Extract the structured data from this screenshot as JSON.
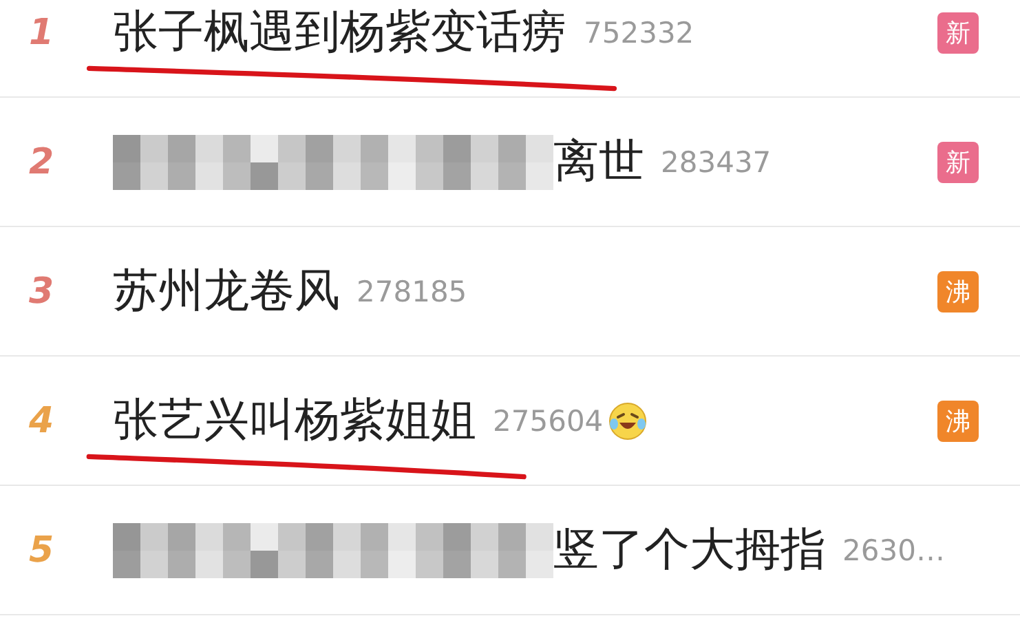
{
  "hot_list": [
    {
      "rank": "1",
      "color": "#e07a72",
      "redacted": false,
      "title": "张子枫遇到杨紫变话痨",
      "count": "752332",
      "emoji": false,
      "underlined": true,
      "badge": {
        "label": "新",
        "color": "#ea6d8c"
      }
    },
    {
      "rank": "2",
      "color": "#e07a72",
      "redacted": true,
      "title": "离世",
      "count": "283437",
      "emoji": false,
      "underlined": false,
      "badge": {
        "label": "新",
        "color": "#ea6d8c"
      }
    },
    {
      "rank": "3",
      "color": "#e07a72",
      "redacted": false,
      "title": "苏州龙卷风",
      "count": "278185",
      "emoji": false,
      "underlined": false,
      "badge": {
        "label": "沸",
        "color": "#f0862a"
      }
    },
    {
      "rank": "4",
      "color": "#eaa24a",
      "redacted": false,
      "title": "张艺兴叫杨紫姐姐",
      "count": "275604",
      "emoji": true,
      "underlined": true,
      "badge": {
        "label": "沸",
        "color": "#f0862a"
      }
    },
    {
      "rank": "5",
      "color": "#eaa24a",
      "redacted": true,
      "title": "竖了个大拇指",
      "count": "2630…",
      "emoji": false,
      "underlined": false
    }
  ]
}
